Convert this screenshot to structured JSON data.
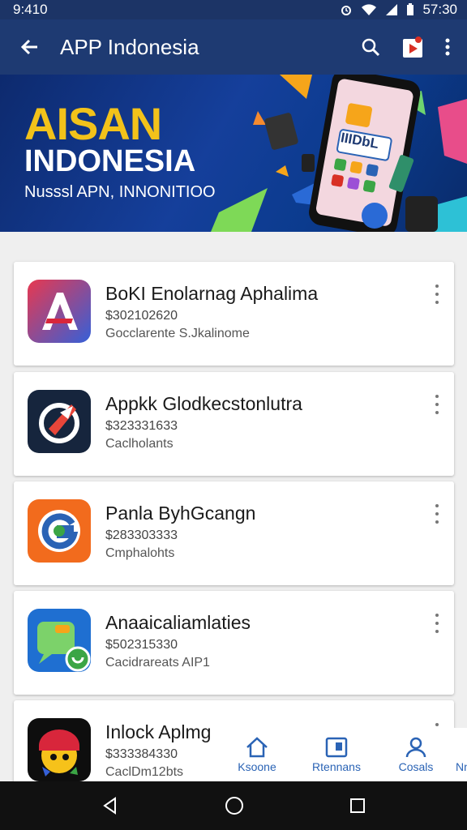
{
  "status_bar": {
    "time_left": "9:410",
    "time_right": "57:30"
  },
  "app_bar": {
    "title": "APP Indonesia"
  },
  "banner": {
    "headline": "AISAN",
    "subheadline": "INDONESIA",
    "tagline": "Nusssl APN, INNONITIOO",
    "phone_text": "IIIDbL"
  },
  "apps": [
    {
      "name": "BoKI Enolarnag Aphalima",
      "price": "$302102620",
      "category": "Gocclarente S.Jkalinome",
      "icon": "red-a-logo-icon"
    },
    {
      "name": "Appkk Glodkecstonlutra",
      "price": "$323331633",
      "category": "Caclholants",
      "icon": "rocket-logo-icon"
    },
    {
      "name": "Panla ByhGcangn",
      "price": "$283303333",
      "category": "Cmphalohts",
      "icon": "orange-g-logo-icon"
    },
    {
      "name": "Anaaicaliamlaties",
      "price": "$502315330",
      "category": "Cacidrareats AIP1",
      "icon": "chat-bubble-logo-icon"
    },
    {
      "name": "Inlock Aplmg",
      "price": "$333384330",
      "category": "CaclDm12bts",
      "icon": "character-logo-icon"
    }
  ],
  "bottom_nav": [
    {
      "label": "Ksoone",
      "icon": "home-icon"
    },
    {
      "label": "Rtennans",
      "icon": "tablet-icon"
    },
    {
      "label": "Cosals",
      "icon": "person-icon"
    },
    {
      "label": "Nn",
      "icon": "more-icon"
    }
  ],
  "colors": {
    "app_bar": "#1e3a72",
    "accent": "#2a63b5",
    "banner_yellow": "#f2c21a"
  }
}
